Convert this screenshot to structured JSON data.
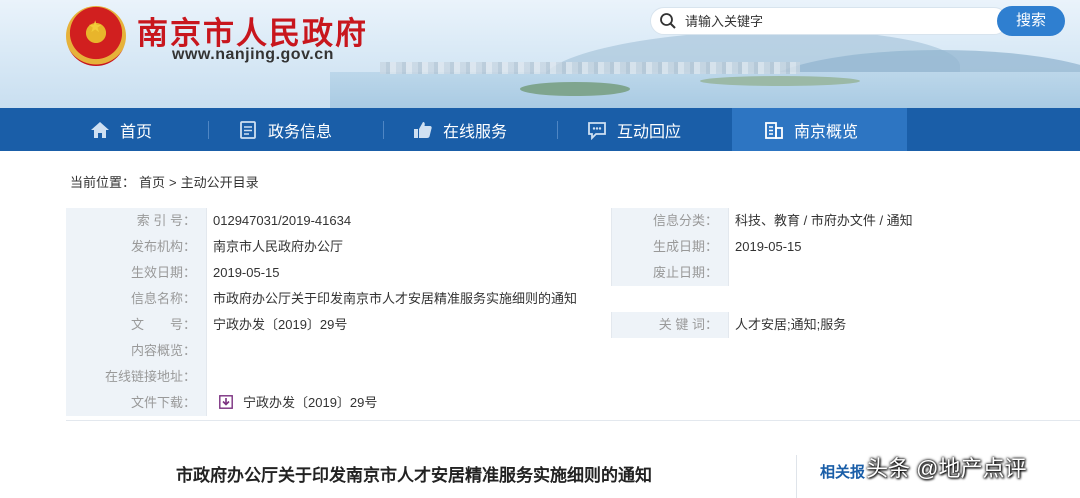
{
  "header": {
    "site_title": "南京市人民政府",
    "site_url": "www.nanjing.gov.cn",
    "search_placeholder": "请输入关键字",
    "search_button": "搜索"
  },
  "nav": {
    "items": [
      {
        "label": "首页",
        "icon": "home-icon"
      },
      {
        "label": "政务信息",
        "icon": "document-icon"
      },
      {
        "label": "在线服务",
        "icon": "thumbs-up-icon"
      },
      {
        "label": "互动回应",
        "icon": "chat-icon"
      },
      {
        "label": "南京概览",
        "icon": "building-icon",
        "active": true
      }
    ]
  },
  "breadcrumb": {
    "prefix": "当前位置：",
    "home": "首页",
    "sep": ">",
    "current": "主动公开目录"
  },
  "meta": {
    "index_label": "索 引 号：",
    "index_value": "012947031/2019-41634",
    "category_label": "信息分类：",
    "category_value": "科技、教育 / 市府办文件 / 通知",
    "publisher_label": "发布机构：",
    "publisher_value": "南京市人民政府办公厅",
    "created_label": "生成日期：",
    "created_value": "2019-05-15",
    "effective_label": "生效日期：",
    "effective_value": "2019-05-15",
    "abolish_label": "废止日期：",
    "abolish_value": "",
    "name_label": "信息名称：",
    "name_value": "市政府办公厅关于印发南京市人才安居精准服务实施细则的通知",
    "docno_label": "文　　号：",
    "docno_value": "宁政办发〔2019〕29号",
    "keywords_label": "关 键 词：",
    "keywords_value": "人才安居;通知;服务",
    "summary_label": "内容概览：",
    "summary_value": "",
    "link_label": "在线链接地址：",
    "link_value": "",
    "download_label": "文件下载：",
    "download_value": "宁政办发〔2019〕29号"
  },
  "article": {
    "title": "市政府办公厅关于印发南京市人才安居精准服务实施细则的通知",
    "related_label": "相关报",
    "watermark": "头条 @地产点评"
  }
}
